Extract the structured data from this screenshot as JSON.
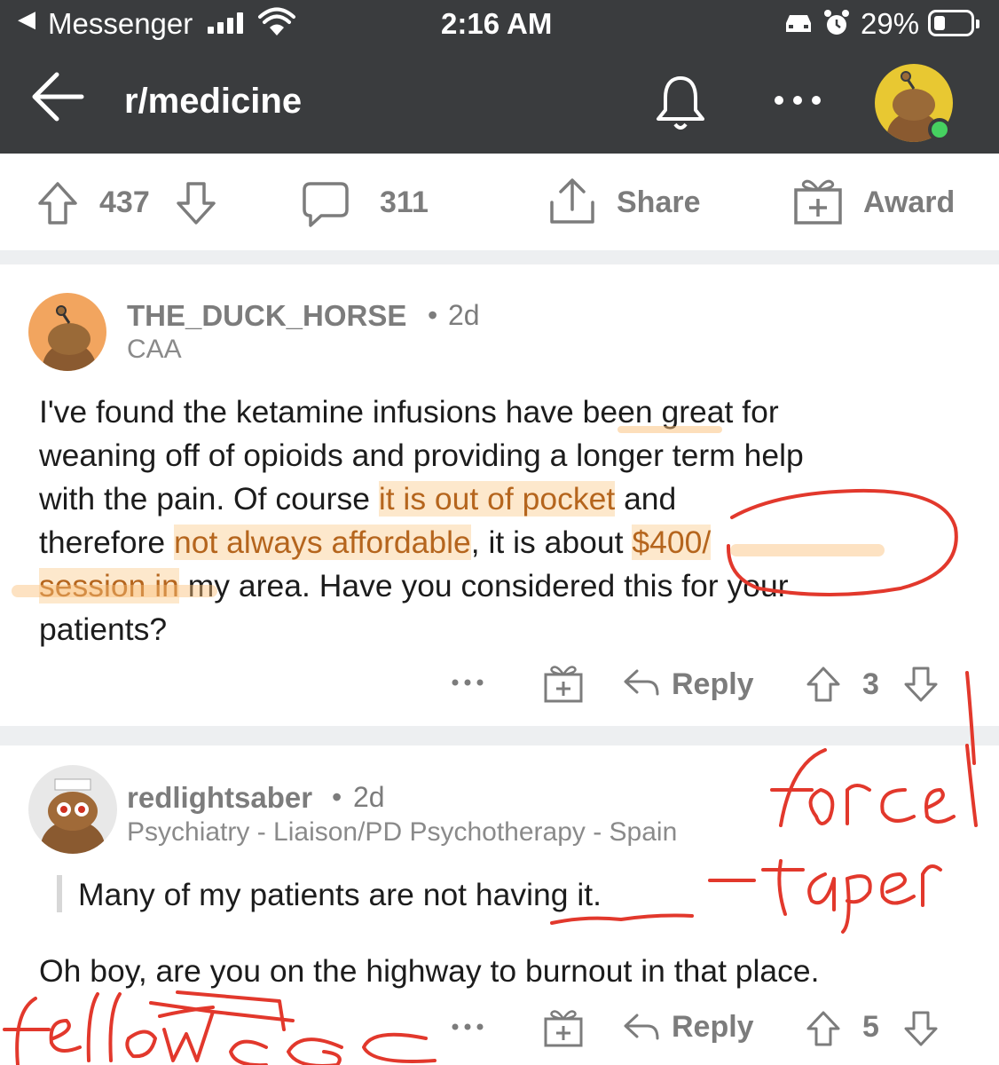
{
  "status_bar": {
    "back_app": "Messenger",
    "time": "2:16 AM",
    "battery": "29%"
  },
  "app_bar": {
    "title": "r/medicine"
  },
  "post_actions": {
    "upvotes": "437",
    "comments": "311",
    "share": "Share",
    "award": "Award"
  },
  "comments": [
    {
      "username": "THE_DUCK_HORSE",
      "age": "2d",
      "flair": "CAA",
      "body": {
        "p1": "I've found the ketamine infusions have been great for\nweaning off of opioids and providing a longer term help\nwith the pain. Of course ",
        "h1": "it is out of pocket",
        "p2": " and\ntherefore ",
        "h2": "not always affordable",
        "p3": ", it is about ",
        "h3": "$400/\nsession in",
        "p4": " my area. Have you considered this for your\npatients?"
      },
      "reply": "Reply",
      "score": "3"
    },
    {
      "username": "redlightsaber",
      "age": "2d",
      "flair": "Psychiatry - Liaison/PD Psychotherapy - Spain",
      "quote": "Many of my patients are not having it.",
      "body": "Oh boy, are you on the highway to burnout in that place.",
      "reply": "Reply",
      "score": "5"
    }
  ],
  "annotations": {
    "note1": "forced taper",
    "note2": "fellow doc"
  },
  "colors": {
    "app_bar": "#3a3c3e",
    "highlight": "#fbbf78",
    "ink": "#e2382c",
    "avatar_top": "#e8c832",
    "avatar_comment1": "#f2a55f"
  }
}
